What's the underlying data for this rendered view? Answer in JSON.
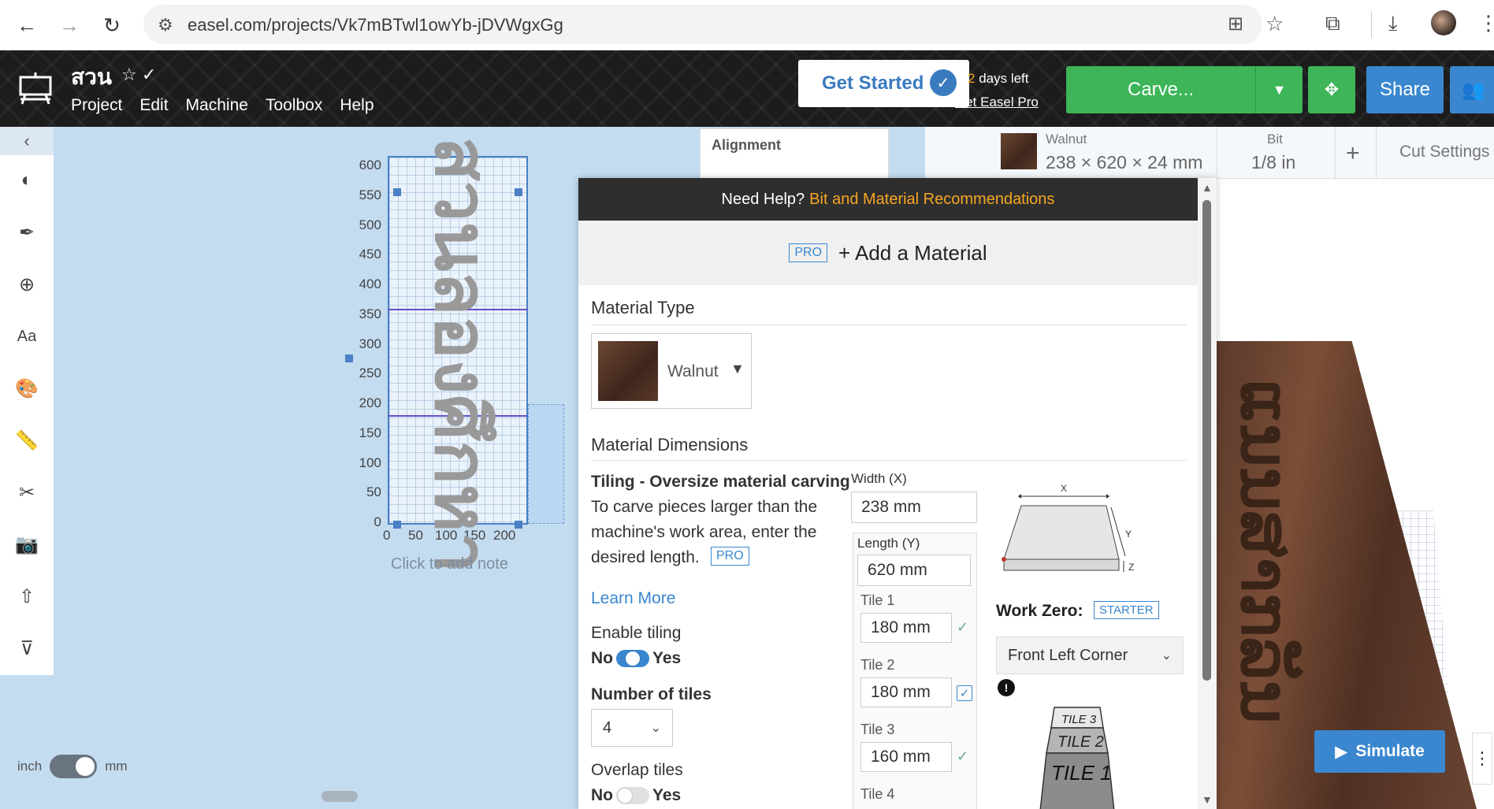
{
  "browser": {
    "url": "easel.com/projects/Vk7mBTwl1owYb-jDVWgxGg"
  },
  "app": {
    "project_title": "สวน",
    "menu": [
      "Project",
      "Edit",
      "Machine",
      "Toolbox",
      "Help"
    ],
    "get_started": "Get Started",
    "days_left_num": "2",
    "days_left_text": " days left",
    "get_pro": "Get Easel Pro",
    "carve": "Carve...",
    "share": "Share"
  },
  "canvas": {
    "y_ticks": [
      "600",
      "550",
      "500",
      "450",
      "400",
      "350",
      "300",
      "250",
      "200",
      "150",
      "100",
      "50",
      "0"
    ],
    "x_ticks": [
      "0",
      "50",
      "100",
      "150",
      "200"
    ],
    "design_text": "สวนลองศึกหา",
    "add_note": "Click to add note",
    "unit_left": "inch",
    "unit_right": "mm"
  },
  "alignment": {
    "title": "Alignment"
  },
  "material_bar": {
    "material_name": "Walnut",
    "material_size": "238 × 620 × 24 mm",
    "bit_label": "Bit",
    "bit_size": "1/8 in",
    "cut_settings": "Cut Settings"
  },
  "preview": {
    "carved_text": "ແນນສາກລັນ",
    "simulate": "Simulate"
  },
  "modal": {
    "help_text": "Need Help?",
    "help_link": "Bit and Material Recommendations",
    "pro_badge": "PRO",
    "add_material": "+ Add a Material",
    "material_type_title": "Material Type",
    "material_selected": "Walnut",
    "dimensions_title": "Material Dimensions",
    "tiling_title": "Tiling - Oversize material carving",
    "tiling_desc_1": "To carve pieces larger than the",
    "tiling_desc_2": "machine's work area, enter the",
    "tiling_desc_3": "desired length.",
    "learn_more": "Learn More",
    "enable_tiling": "Enable tiling",
    "no": "No",
    "yes": "Yes",
    "number_of_tiles": "Number of tiles",
    "tiles_value": "4",
    "overlap_tiles": "Overlap tiles",
    "width_label": "Width (X)",
    "width_value": "238 mm",
    "length_label": "Length (Y)",
    "length_value": "620 mm",
    "tiles": [
      {
        "label": "Tile 1",
        "value": "180 mm"
      },
      {
        "label": "Tile 2",
        "value": "180 mm"
      },
      {
        "label": "Tile 3",
        "value": "160 mm"
      },
      {
        "label": "Tile 4",
        "value": ""
      }
    ],
    "work_zero": "Work Zero:",
    "starter_badge": "STARTER",
    "work_zero_value": "Front Left Corner",
    "diagram_x": "X",
    "diagram_y": "Y",
    "diagram_z": "Z",
    "tile_stack": [
      "TILE 3",
      "TILE 2",
      "TILE 1"
    ]
  }
}
